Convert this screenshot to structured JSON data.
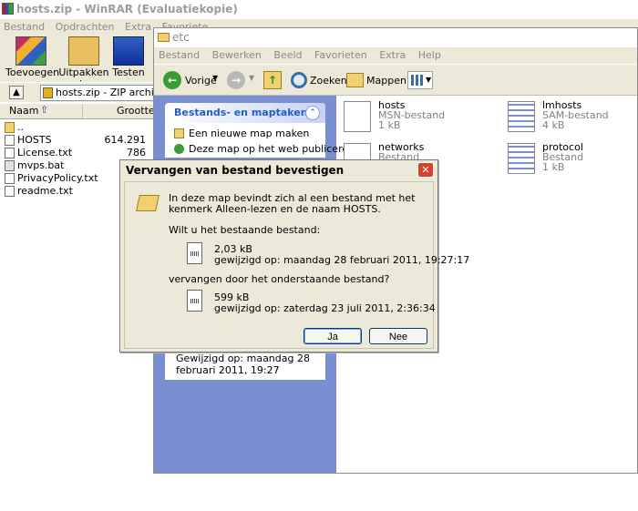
{
  "winrar": {
    "title": "hosts.zip - WinRAR (Evaluatiekopie)",
    "menu": [
      "Bestand",
      "Opdrachten",
      "Extra",
      "Favoriete"
    ],
    "toolbar": {
      "add": "Toevoegen",
      "extract": "Uitpakken in",
      "test": "Testen"
    },
    "address": "hosts.zip - ZIP archief, oor",
    "columns": {
      "name": "Naam",
      "size": "Grootte"
    },
    "files": [
      {
        "name": "..",
        "size": ""
      },
      {
        "name": "HOSTS",
        "size": "614.291"
      },
      {
        "name": "License.txt",
        "size": "786"
      },
      {
        "name": "mvps.bat",
        "size": ""
      },
      {
        "name": "PrivacyPolicy.txt",
        "size": ""
      },
      {
        "name": "readme.txt",
        "size": ""
      }
    ]
  },
  "explorer": {
    "title": "etc",
    "menu": [
      "Bestand",
      "Bewerken",
      "Beeld",
      "Favorieten",
      "Extra",
      "Help"
    ],
    "toolbar": {
      "back": "Vorige",
      "search": "Zoeken",
      "folders": "Mappen"
    },
    "tasks": {
      "title": "Bestands- en maptaken",
      "items": [
        "Een nieuwe map maken",
        "Deze map op het web publiceren"
      ]
    },
    "details": "Gewijzigd op: maandag 28 februari 2011, 19:27",
    "files": [
      {
        "name": "hosts",
        "type": "MSN-bestand",
        "size": "1 kB"
      },
      {
        "name": "lmhosts",
        "type": "SAM-bestand",
        "size": "4 kB"
      },
      {
        "name": "networks",
        "type": "Bestand",
        "size": ""
      },
      {
        "name": "protocol",
        "type": "Bestand",
        "size": "1 kB"
      }
    ]
  },
  "dialog": {
    "title": "Vervangen van bestand bevestigen",
    "message": "In deze map bevindt zich al een bestand met het kenmerk Alleen-lezen en de naam HOSTS.",
    "question1": "Wilt u het bestaande bestand:",
    "existing": {
      "size": "2,03 kB",
      "modified": "gewijzigd op: maandag 28 februari 2011, 19:27:17"
    },
    "question2": "vervangen door het onderstaande bestand?",
    "replacement": {
      "size": "599 kB",
      "modified": "gewijzigd op: zaterdag 23 juli 2011, 2:36:34"
    },
    "yes": "Ja",
    "no": "Nee"
  }
}
